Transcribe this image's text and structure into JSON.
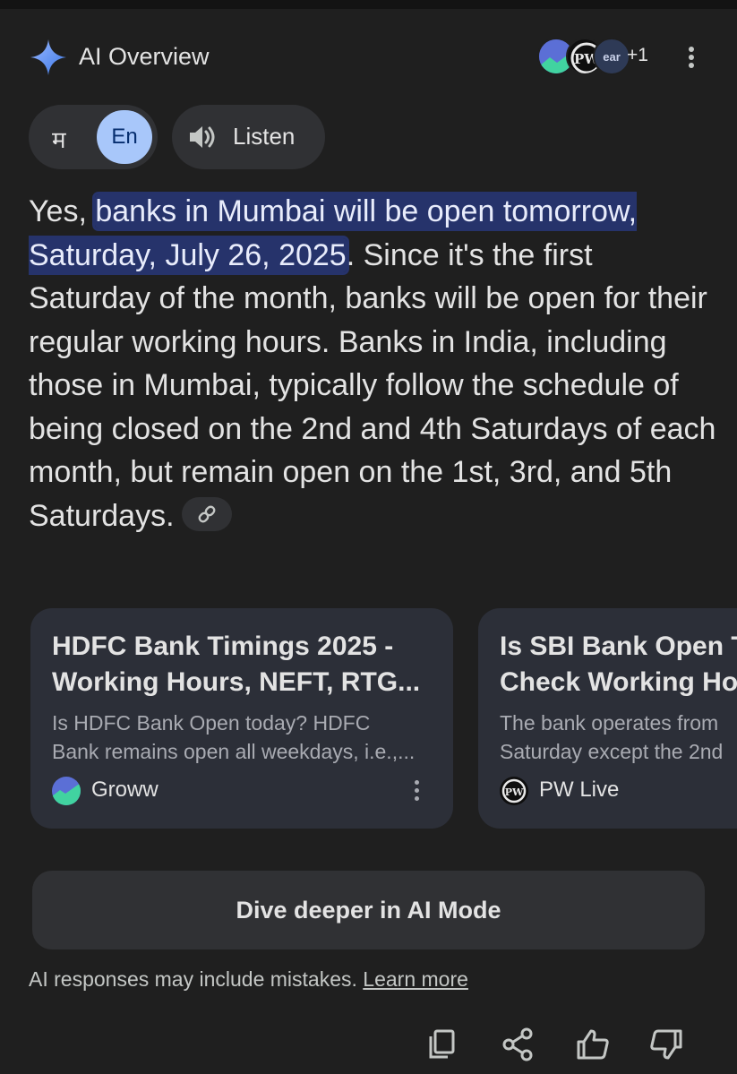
{
  "header": {
    "title": "AI Overview",
    "sources_extra_count": "+1",
    "source_avatar_3_text": "ear"
  },
  "language": {
    "option_hindi": "म",
    "option_english": "En",
    "selected": "En"
  },
  "listen": {
    "label": "Listen"
  },
  "answer": {
    "prefix": "Yes, ",
    "highlight": "banks in Mumbai will be open tomorrow, Saturday, July 26, 2025",
    "body": ". Since it's the first Saturday of the month, banks will be open for their regular working hours. Banks in India, including those in Mumbai, typically follow the schedule of being closed on the 2nd and 4th Saturdays of each month, but remain open on the 1st, 3rd, and 5th Saturdays."
  },
  "cards": [
    {
      "title_line1": "HDFC Bank Timings 2025 -",
      "title_line2": "Working Hours, NEFT, RTG...",
      "snippet_line1": "Is HDFC Bank Open today? HDFC",
      "snippet_line2": "Bank remains open all weekdays, i.e.,...",
      "source": "Groww"
    },
    {
      "title_line1": "Is SBI Bank Open T",
      "title_line2": "Check Working Ho",
      "snippet_line1": "The bank operates from",
      "snippet_line2": "Saturday except the 2nd",
      "source": "PW Live"
    }
  ],
  "dive_deeper": {
    "label": "Dive deeper in AI Mode"
  },
  "footer": {
    "disclaimer": "AI responses may include mistakes.",
    "learn_more": "Learn more"
  },
  "colors": {
    "background": "#1f1f1f",
    "highlight": "#26336b",
    "accent": "#a8c7fa",
    "card": "#2c2f38"
  },
  "icons": [
    "sparkle-icon",
    "speaker-icon",
    "link-icon",
    "kebab-menu-icon",
    "copy-icon",
    "share-icon",
    "thumbs-up-icon",
    "thumbs-down-icon"
  ]
}
